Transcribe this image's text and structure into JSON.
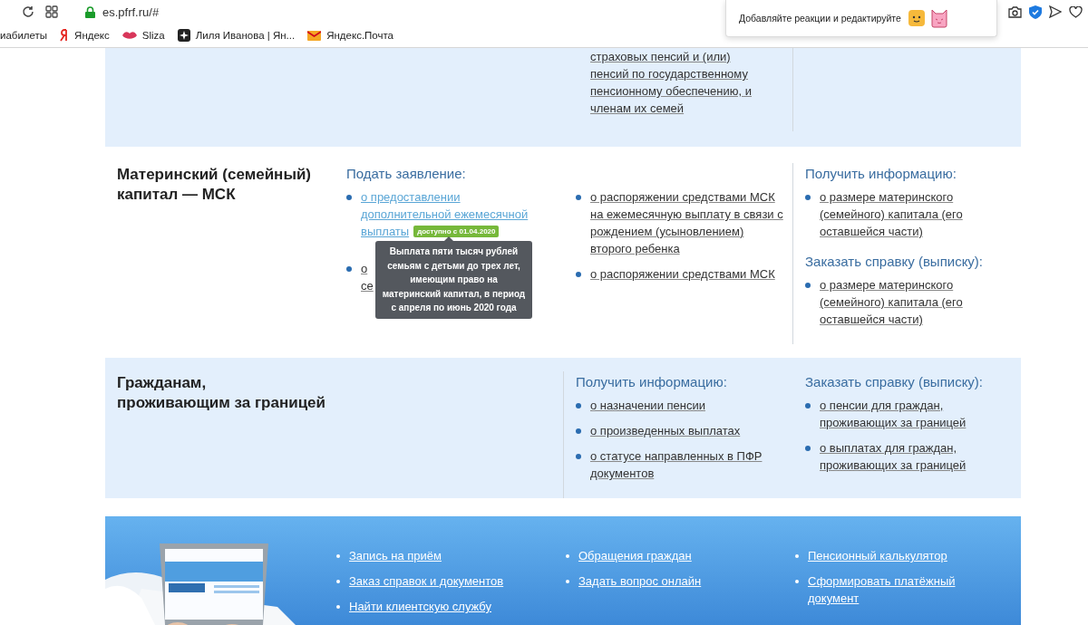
{
  "browser": {
    "url": "es.pfrf.ru/#",
    "bookmarks": [
      {
        "kind": "plain",
        "label": "иабилеты"
      },
      {
        "kind": "yandex",
        "label": "Яндекс"
      },
      {
        "kind": "sliza",
        "label": "Sliza"
      },
      {
        "kind": "star",
        "label": "Лиля Иванова | Ян..."
      },
      {
        "kind": "mail",
        "label": "Яндекс.Почта"
      }
    ],
    "popup": {
      "text": "Добавляйте реакции и редактируйте"
    }
  },
  "sections": [
    {
      "kind": "light",
      "columns": [
        {
          "kind": "plain"
        },
        {
          "kind": "plain",
          "groups": [
            {
              "items": [
                {
                  "kind": "continuation",
                  "text": "страховых пенсий и (или) пенсий по государственному пенсионному обеспечению, и членам их семей",
                  "hovered": false
                }
              ]
            }
          ]
        },
        {
          "kind": "divided"
        }
      ]
    },
    {
      "kind": "white",
      "title": [
        "Материнский (семейный)",
        "капитал — МСК"
      ],
      "columns": [
        {
          "kind": "plain",
          "groups": [
            {
              "heading": "Подать заявление:",
              "items": [
                {
                  "kind": "bullet",
                  "text": "о предоставлении дополнительной ежемесячной выплаты",
                  "hovered": true,
                  "badge": "доступно с 01.04.2020",
                  "tooltip": "Выплата пяти тысяч рублей семьям с детьми до трех лет, имеющим право на материнский капитал, в период с апреля по июнь 2020 года"
                },
                {
                  "kind": "covered",
                  "lines": [
                    "о",
                    "се"
                  ],
                  "hovered": false
                }
              ]
            }
          ]
        },
        {
          "kind": "plain",
          "groups": [
            {
              "items": [
                {
                  "kind": "bullet",
                  "text": "о распоряжении средствами МСК на ежемесячную выплату в связи с рождением (усыновлением) второго ребенка",
                  "hovered": false
                },
                {
                  "kind": "bullet",
                  "text": "о распоряжении средствами МСК",
                  "hovered": false
                }
              ]
            }
          ]
        },
        {
          "kind": "divided",
          "groups": [
            {
              "heading": "Получить информацию:",
              "items": [
                {
                  "kind": "bullet",
                  "text": "о размере материнского (семейного) капитала (его оставшейся части)",
                  "hovered": false
                }
              ]
            },
            {
              "heading": "Заказать справку (выписку):",
              "items": [
                {
                  "kind": "bullet",
                  "text": "о размере материнского (семейного) капитала (его оставшейся части)",
                  "hovered": false
                }
              ]
            }
          ]
        }
      ]
    },
    {
      "kind": "light",
      "title": [
        "Гражданам,",
        "проживающим за границей"
      ],
      "columns": [
        {
          "kind": "plain"
        },
        {
          "kind": "divided",
          "groups": [
            {
              "heading": "Получить информацию:",
              "items": [
                {
                  "kind": "bullet",
                  "text": "о назначении пенсии",
                  "hovered": false
                },
                {
                  "kind": "bullet",
                  "text": "о произведенных выплатах",
                  "hovered": false
                },
                {
                  "kind": "bullet",
                  "text": "о статусе направленных в ПФР документов",
                  "hovered": false
                }
              ]
            }
          ]
        },
        {
          "kind": "plain",
          "groups": [
            {
              "heading": "Заказать справку (выписку):",
              "items": [
                {
                  "kind": "bullet",
                  "text": "о пенсии для граждан, проживающих за границей",
                  "hovered": false
                },
                {
                  "kind": "bullet",
                  "text": "о выплатах для граждан, проживающих за границей",
                  "hovered": false
                }
              ]
            }
          ]
        }
      ]
    }
  ],
  "footer": {
    "kind": "picture",
    "columns": [
      [
        "Запись на приём",
        "Заказ справок и документов",
        "Найти клиентскую службу"
      ],
      [
        "Обращения граждан",
        "Задать вопрос онлайн"
      ],
      [
        "Пенсионный калькулятор",
        "Сформировать платёжный документ"
      ]
    ]
  }
}
